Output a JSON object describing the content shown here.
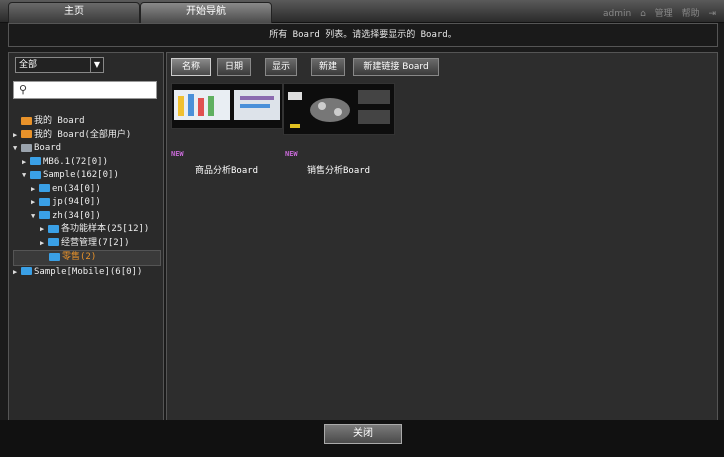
{
  "tabs": {
    "home": "主页",
    "start_nav": "开始导航"
  },
  "topright": {
    "user": "admin",
    "manage": "管理",
    "help": "帮助"
  },
  "message": "所有 Board 列表。请选择要显示的 Board。",
  "filter": {
    "selected": "全部"
  },
  "search": {
    "value": ""
  },
  "tree": [
    {
      "label": "我的 Board",
      "icon": "folder-orange-icon",
      "expander": "",
      "indent": 0
    },
    {
      "label": "我的 Board(全部用户)",
      "icon": "folder-orange-icon",
      "expander": "▶",
      "indent": 0
    },
    {
      "label": "Board",
      "icon": "folder-grey-icon",
      "expander": "▼",
      "indent": 0
    },
    {
      "label": "MB6.1(72[0])",
      "icon": "folder-blue-icon",
      "expander": "▶",
      "indent": 1
    },
    {
      "label": "Sample(162[0])",
      "icon": "folder-blue-icon",
      "expander": "▼",
      "indent": 1
    },
    {
      "label": "en(34[0])",
      "icon": "folder-blue-icon",
      "expander": "▶",
      "indent": 2
    },
    {
      "label": "jp(94[0])",
      "icon": "folder-blue-icon",
      "expander": "▶",
      "indent": 2
    },
    {
      "label": "zh(34[0])",
      "icon": "folder-blue-icon",
      "expander": "▼",
      "indent": 2
    },
    {
      "label": "各功能样本(25[12])",
      "icon": "folder-blue-icon",
      "expander": "▶",
      "indent": 3
    },
    {
      "label": "经营管理(7[2])",
      "icon": "folder-blue-icon",
      "expander": "▶",
      "indent": 3
    },
    {
      "label": "零售(2)",
      "icon": "folder-blue-icon",
      "expander": "",
      "indent": 3,
      "selected": true
    },
    {
      "label": "Sample[Mobile](6[0])",
      "icon": "folder-blue-icon",
      "expander": "▶",
      "indent": 0
    }
  ],
  "toolbar": {
    "name": "名称",
    "date": "日期",
    "show": "显示",
    "new": "新建",
    "new_link": "新建链接 Board"
  },
  "boards": [
    {
      "label": "商品分析Board",
      "badge": "NEW"
    },
    {
      "label": "销售分析Board",
      "badge": "NEW"
    }
  ],
  "close": "关闭",
  "colors": {
    "background": "#1b1b1b",
    "panel": "#2d2d2d",
    "selected_text": "#e8922a",
    "badge": "#c86ad8"
  }
}
